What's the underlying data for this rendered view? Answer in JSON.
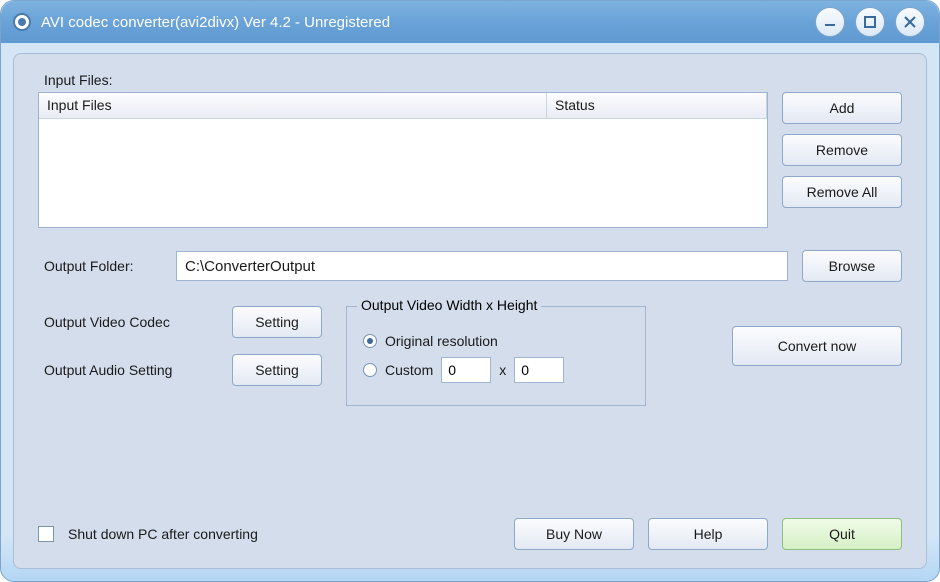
{
  "title": "AVI codec converter(avi2divx) Ver 4.2 - Unregistered",
  "labels": {
    "input_files": "Input Files:",
    "output_folder": "Output Folder:",
    "output_video_codec": "Output Video Codec",
    "output_audio_setting": "Output Audio Setting",
    "fieldset_legend": "Output Video Width x Height",
    "original_resolution": "Original resolution",
    "custom": "Custom",
    "dim_sep": "x",
    "shutdown": "Shut down PC after converting"
  },
  "columns": {
    "files": "Input Files",
    "status": "Status"
  },
  "buttons": {
    "add": "Add",
    "remove": "Remove",
    "remove_all": "Remove All",
    "browse": "Browse",
    "setting_video": "Setting",
    "setting_audio": "Setting",
    "convert": "Convert now",
    "buy": "Buy Now",
    "help": "Help",
    "quit": "Quit"
  },
  "values": {
    "output_folder": "C:\\ConverterOutput",
    "width": "0",
    "height": "0",
    "resolution_mode": "original",
    "shutdown_checked": false
  }
}
